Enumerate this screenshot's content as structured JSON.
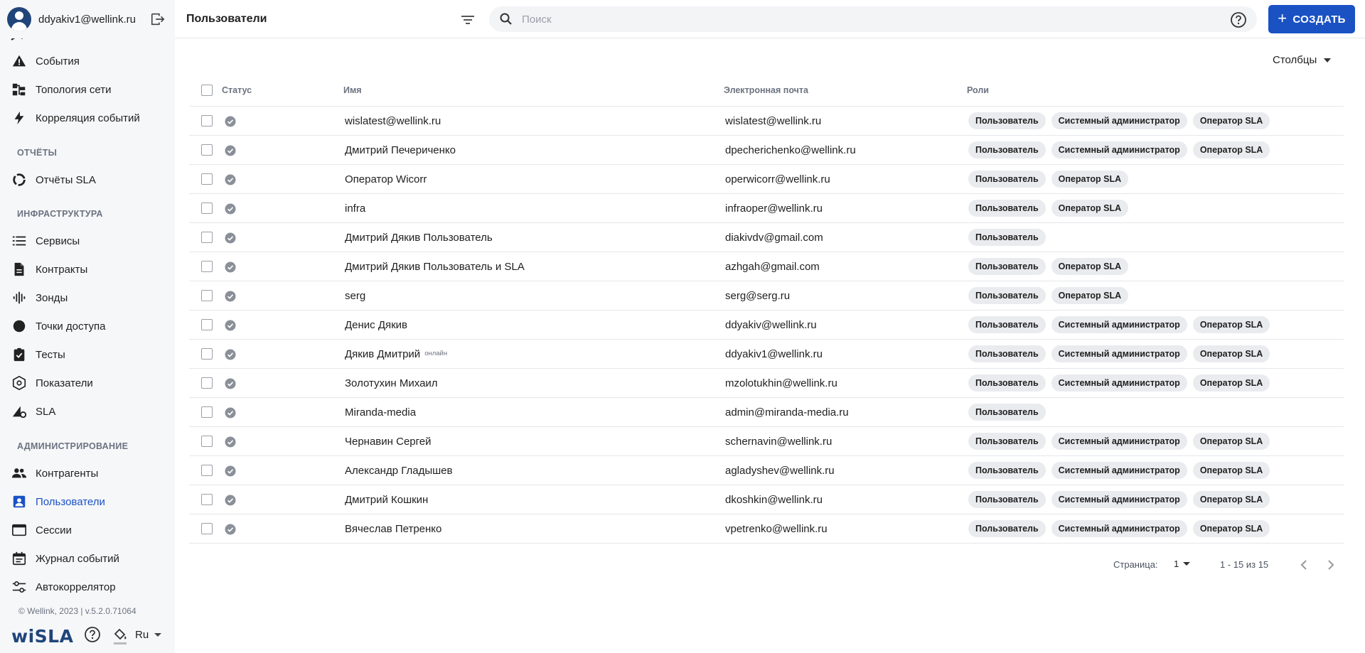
{
  "user": {
    "email": "ddyakiv1@wellink.ru"
  },
  "sidebar": {
    "items": [
      {
        "label": "События",
        "icon": "warning-icon"
      },
      {
        "label": "Топология сети",
        "icon": "topology-icon"
      },
      {
        "label": "Корреляция событий",
        "icon": "lightning-icon"
      }
    ],
    "section_reports": "ОТЧЁТЫ",
    "reports_items": [
      {
        "label": "Отчёты SLA",
        "icon": "donut-chart-icon"
      }
    ],
    "section_infra": "ИНФРАСТРУКТУРА",
    "infra_items": [
      {
        "label": "Сервисы",
        "icon": "list-icon"
      },
      {
        "label": "Контракты",
        "icon": "document-icon"
      },
      {
        "label": "Зонды",
        "icon": "probe-icon"
      },
      {
        "label": "Точки доступа",
        "icon": "circle-icon"
      },
      {
        "label": "Тесты",
        "icon": "clipboard-check-icon"
      },
      {
        "label": "Показатели",
        "icon": "metrics-icon"
      },
      {
        "label": "SLA",
        "icon": "sla-icon"
      }
    ],
    "section_admin": "АДМИНИСТРИРОВАНИЕ",
    "admin_items": [
      {
        "label": "Контрагенты",
        "icon": "people-icon"
      },
      {
        "label": "Пользователи",
        "icon": "user-badge-icon",
        "active": true
      },
      {
        "label": "Сессии",
        "icon": "window-icon"
      },
      {
        "label": "Журнал событий",
        "icon": "calendar-icon"
      },
      {
        "label": "Автокоррелятор",
        "icon": "sliders-icon"
      }
    ],
    "copyright": "© Wellink, 2023 | v.5.2.0.71064",
    "logo": "wiSLA",
    "language": "Ru"
  },
  "header": {
    "title": "Пользователи",
    "search_placeholder": "Поиск",
    "create_label": "СОЗДАТЬ"
  },
  "toolbar": {
    "columns_label": "Столбцы"
  },
  "table": {
    "headers": {
      "status": "Статус",
      "name": "Имя",
      "email": "Электронная почта",
      "roles": "Роли"
    },
    "rows": [
      {
        "name": "wislatest@wellink.ru",
        "email": "wislatest@wellink.ru",
        "roles": [
          "Пользователь",
          "Системный администратор",
          "Оператор SLA"
        ]
      },
      {
        "name": "Дмитрий Печериченко",
        "email": "dpecherichenko@wellink.ru",
        "roles": [
          "Пользователь",
          "Системный администратор",
          "Оператор SLA"
        ]
      },
      {
        "name": "Оператор Wicorr",
        "email": "operwicorr@wellink.ru",
        "roles": [
          "Пользователь",
          "Оператор SLA"
        ]
      },
      {
        "name": "infra",
        "email": "infraoper@wellink.ru",
        "roles": [
          "Пользователь",
          "Оператор SLA"
        ]
      },
      {
        "name": "Дмитрий Дякив Пользователь",
        "email": "diakivdv@gmail.com",
        "roles": [
          "Пользователь"
        ]
      },
      {
        "name": "Дмитрий Дякив Пользователь и SLA",
        "email": "azhgah@gmail.com",
        "roles": [
          "Пользователь",
          "Оператор SLA"
        ]
      },
      {
        "name": "serg",
        "email": "serg@serg.ru",
        "roles": [
          "Пользователь",
          "Оператор SLA"
        ]
      },
      {
        "name": "Денис Дякив",
        "email": "ddyakiv@wellink.ru",
        "roles": [
          "Пользователь",
          "Системный администратор",
          "Оператор SLA"
        ]
      },
      {
        "name": "Дякив Дмитрий",
        "online": "онлайн",
        "email": "ddyakiv1@wellink.ru",
        "roles": [
          "Пользователь",
          "Системный администратор",
          "Оператор SLA"
        ]
      },
      {
        "name": "Золотухин Михаил",
        "email": "mzolotukhin@wellink.ru",
        "roles": [
          "Пользователь",
          "Системный администратор",
          "Оператор SLA"
        ]
      },
      {
        "name": "Miranda-media",
        "email": "admin@miranda-media.ru",
        "roles": [
          "Пользователь"
        ]
      },
      {
        "name": "Чернавин Сергей",
        "email": "schernavin@wellink.ru",
        "roles": [
          "Пользователь",
          "Системный администратор",
          "Оператор SLA"
        ]
      },
      {
        "name": "Александр Гладышев",
        "email": "agladyshev@wellink.ru",
        "roles": [
          "Пользователь",
          "Системный администратор",
          "Оператор SLA"
        ]
      },
      {
        "name": "Дмитрий Кошкин",
        "email": "dkoshkin@wellink.ru",
        "roles": [
          "Пользователь",
          "Системный администратор",
          "Оператор SLA"
        ]
      },
      {
        "name": "Вячеслав Петренко",
        "email": "vpetrenko@wellink.ru",
        "roles": [
          "Пользователь",
          "Системный администратор",
          "Оператор SLA"
        ]
      }
    ]
  },
  "pagination": {
    "page_label": "Страница:",
    "page": "1",
    "range": "1 - 15 из 15"
  },
  "colors": {
    "accent": "#1a52c4",
    "brand": "#20457a",
    "chip_bg": "#e9ebee",
    "status_icon": "#8a8f98"
  }
}
